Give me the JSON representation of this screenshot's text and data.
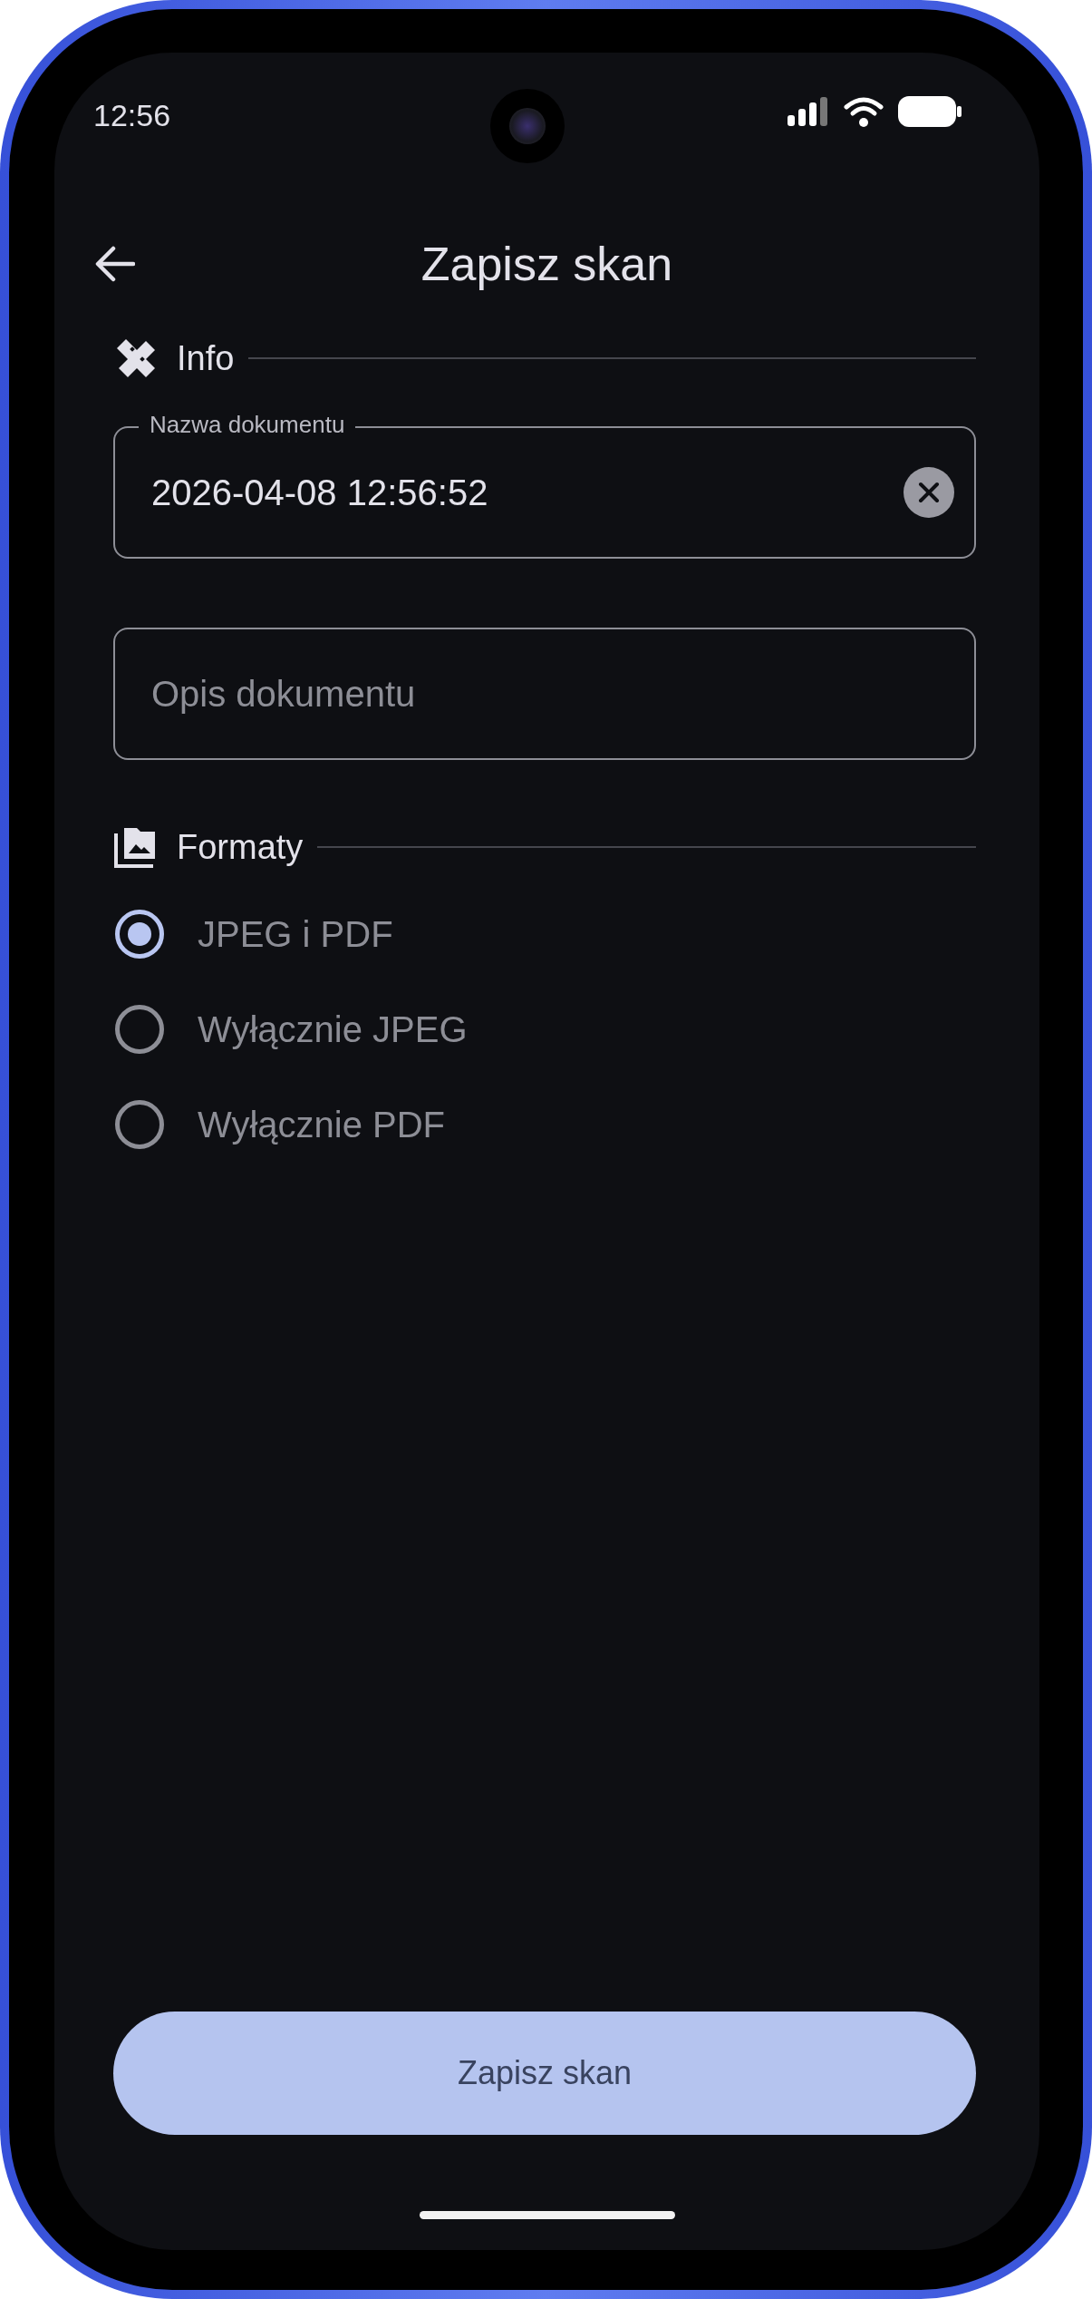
{
  "status_bar": {
    "time": "12:56"
  },
  "header": {
    "title": "Zapisz skan"
  },
  "sections": [
    {
      "kind": "info",
      "title": "Info",
      "fields": [
        {
          "label": "Nazwa dokumentu",
          "value": "2026-04-08 12:56:52",
          "clearable": true
        },
        {
          "placeholder": "Opis dokumentu"
        }
      ]
    },
    {
      "kind": "formats",
      "title": "Formaty",
      "options": [
        {
          "label": "JPEG i PDF",
          "selected": true
        },
        {
          "label": "Wyłącznie JPEG",
          "selected": false
        },
        {
          "label": "Wyłącznie PDF",
          "selected": false
        }
      ]
    }
  ],
  "save_button": {
    "label": "Zapisz skan"
  }
}
